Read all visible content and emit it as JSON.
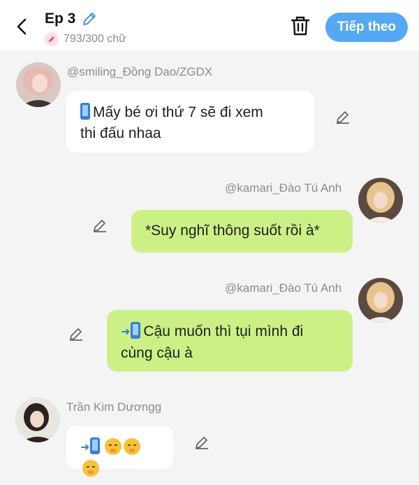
{
  "header": {
    "episode_title": "Ep 3",
    "word_count": "793/300 chữ",
    "next_button": "Tiếp theo"
  },
  "messages": [
    {
      "username": "@smiling_Đồng Dao/ZGDX",
      "text": "Mấy bé ơi thứ 7 sẽ đi xem",
      "text_line2": "thi đấu nhaa"
    },
    {
      "username": "@kamari_Đào Tú Anh",
      "text": "*Suy nghĩ thông suốt rồi à*"
    },
    {
      "username": "@kamari_Đào Tú Anh",
      "text": "Cậu muốn thì tụi mình đi",
      "text_line2": "cùng cậu à"
    },
    {
      "username": "Trần Kim Dươngg",
      "text": ""
    }
  ],
  "icons": {
    "back": "chevron-left-icon",
    "edit_title": "pencil-icon",
    "count_badge": "pencil-icon",
    "delete": "trash-icon",
    "message_edit": "pencil-icon",
    "phone": "mobile-phone-icon",
    "incoming_phone": "mobile-phone-arrow-icon",
    "emoji": "shushing-face-icon"
  },
  "colors": {
    "accent": "#55a8f3",
    "sent_bubble": "#cdf086",
    "received_bubble": "#ffffff",
    "background": "#f4f4f4"
  }
}
